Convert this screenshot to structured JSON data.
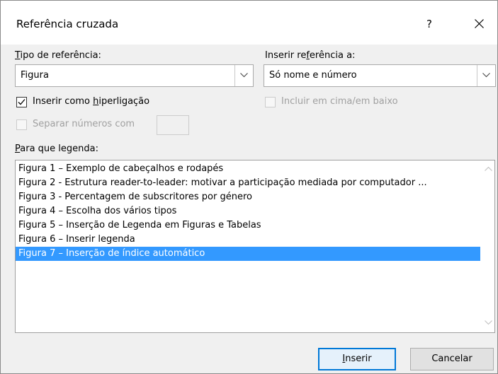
{
  "dialog": {
    "title": "Referência cruzada",
    "help_label": "?",
    "close_icon": "close-icon"
  },
  "ref_type": {
    "label_first": "T",
    "label_rest": "ipo de referência:",
    "value": "Figura"
  },
  "insert_ref": {
    "label_before": "Inserir re",
    "label_underlined": "f",
    "label_after": "erência a:",
    "value": "Só nome e número"
  },
  "hyperlink_checkbox": {
    "label_before": "Inserir como ",
    "label_underlined": "h",
    "label_after": "iperligação",
    "checked": true
  },
  "above_below_checkbox": {
    "label": "Incluir em cima/em baixo",
    "checked": false,
    "enabled": false
  },
  "separate_numbers": {
    "label": "Separar números com",
    "value": "",
    "enabled": false
  },
  "caption_list": {
    "label_first": "P",
    "label_rest": "ara que legenda:",
    "items": [
      "Figura 1 – Exemplo de cabeçalhos e rodapés",
      "Figura 2 - Estrutura reader-to-leader: motivar a participação mediada por computador ...",
      "Figura 3 - Percentagem de subscritores por género",
      "Figura 4 – Escolha dos vários tipos",
      "Figura 5 – Inserção de Legenda em Figuras e Tabelas",
      "Figura 6 – Inserir legenda",
      "Figura 7 – Inserção de índice automático"
    ],
    "selected_index": 6
  },
  "buttons": {
    "insert_first": "I",
    "insert_rest": "nserir",
    "cancel": "Cancelar"
  },
  "colors": {
    "selection": "#3399ff",
    "default_button_border": "#0078d7",
    "dialog_background": "#f0f0f0"
  }
}
